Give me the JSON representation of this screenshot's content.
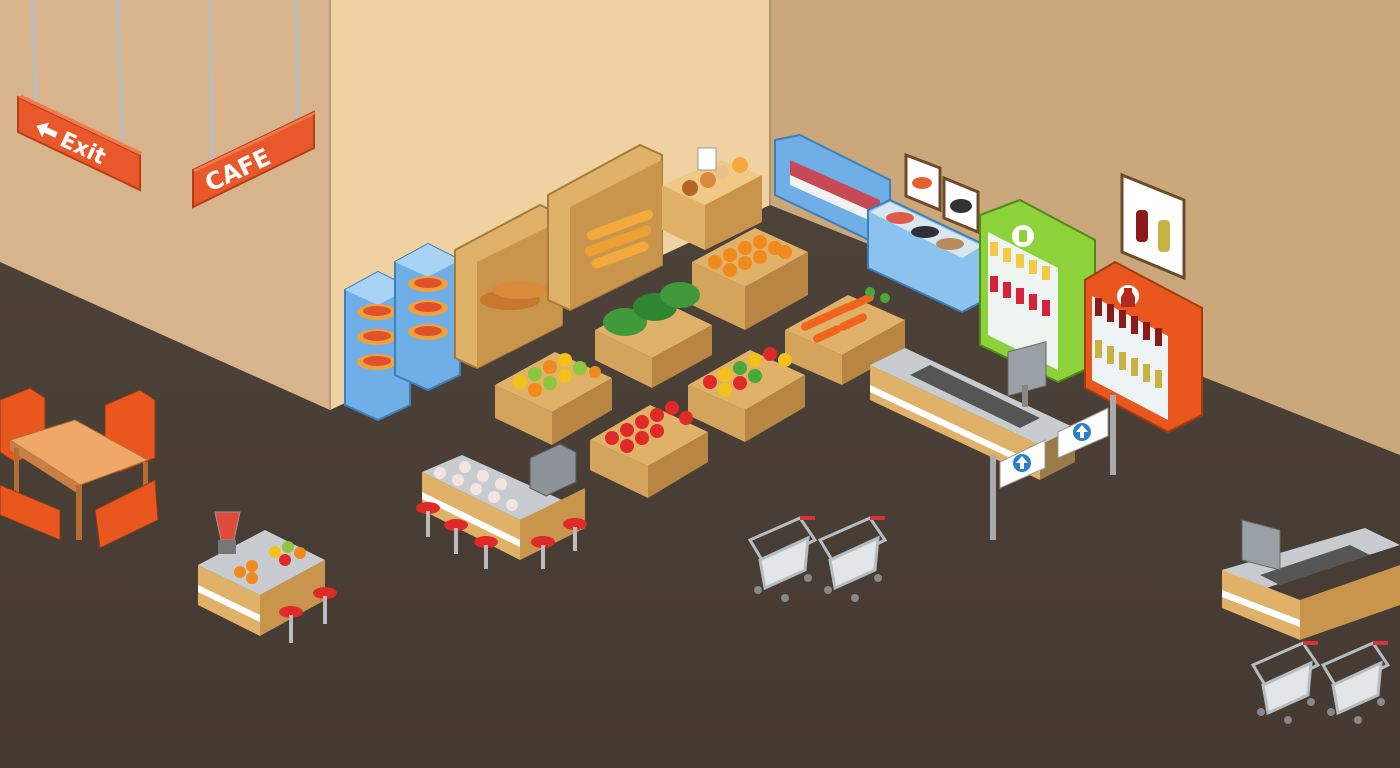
{
  "signs": {
    "exit": "Exit",
    "cafe": "CAFE"
  },
  "icons": {
    "exit_arrow": "arrow-left-icon",
    "gate_arrow": "arrow-up-icon",
    "shelf_badge": "bottle-icon"
  },
  "colors": {
    "floor": "#4a3f37",
    "wall_left": "#d8b48c",
    "wall_back": "#f0d2a2",
    "wall_right": "#caa87b",
    "sign": "#e9582b",
    "crate": "#e0b168",
    "fridge_blue": "#6faee6",
    "shelf_green": "#8dd23a",
    "shelf_red": "#e9571f",
    "counter": "#9aa1a6"
  }
}
